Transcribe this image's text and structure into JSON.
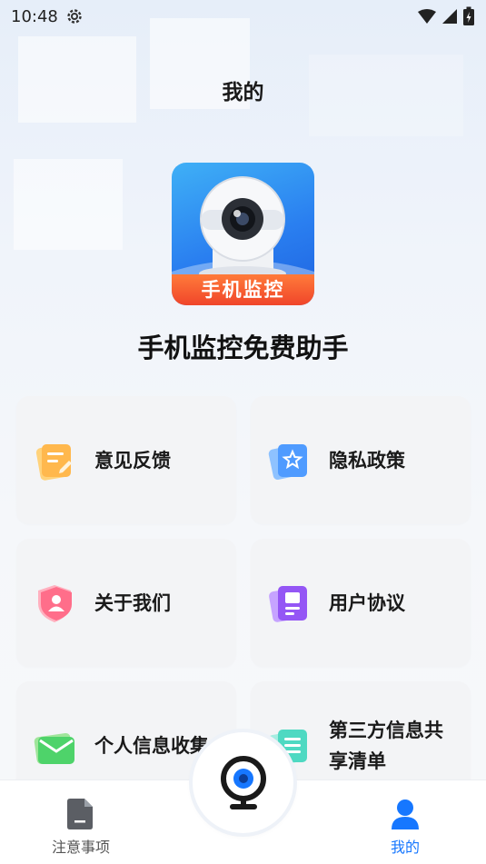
{
  "status_bar": {
    "time": "10:48"
  },
  "header": {
    "title": "我的"
  },
  "app": {
    "logo_text": "手机监控",
    "name": "手机监控免费助手"
  },
  "menu": {
    "feedback": "意见反馈",
    "privacy": "隐私政策",
    "about": "关于我们",
    "agreement": "用户协议",
    "personal_info": "个人信息收集",
    "third_party_line1": "第三方信息共",
    "third_party_line2": "享清单"
  },
  "tabbar": {
    "notes_label": "注意事项",
    "mine_label": "我的",
    "active_color": "#1677ff",
    "inactive_color": "#555555"
  },
  "icons": {
    "status": [
      "gear-icon",
      "wifi-icon",
      "signal-icon",
      "battery-icon"
    ],
    "menu": [
      "feedback-icon",
      "privacy-icon",
      "about-icon",
      "agreement-icon",
      "mail-icon",
      "list-icon"
    ],
    "tabbar": [
      "document-icon",
      "camera-icon",
      "user-icon"
    ]
  }
}
